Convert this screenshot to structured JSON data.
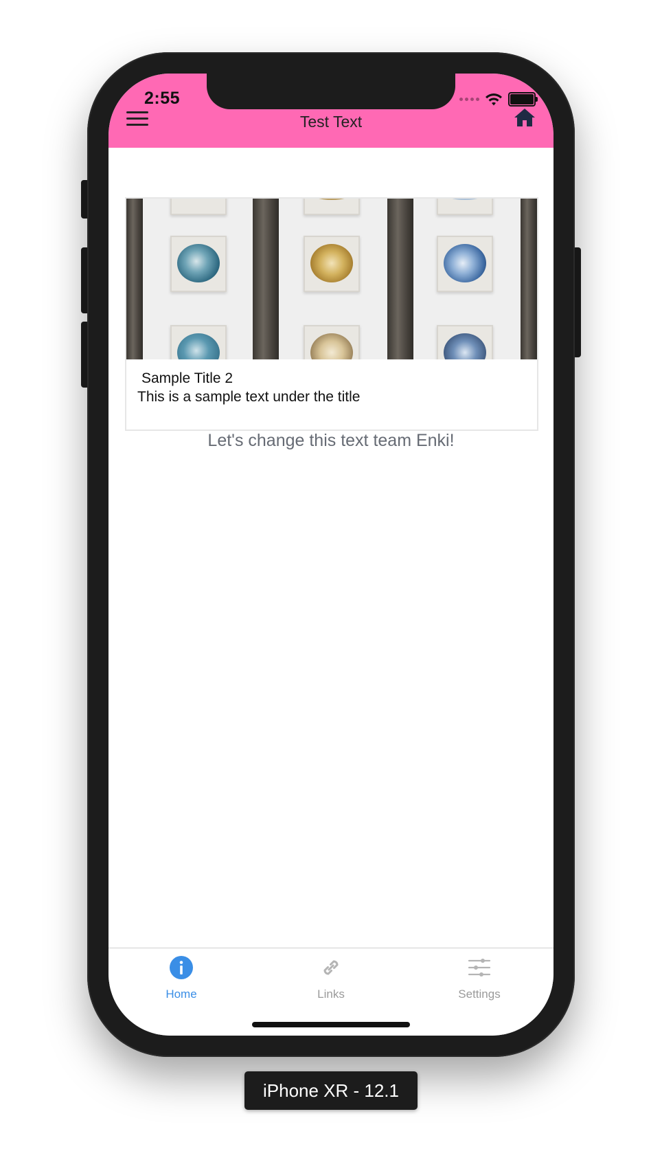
{
  "status_bar": {
    "time": "2:55"
  },
  "header": {
    "title": "Test Text",
    "menu_icon": "hamburger-icon",
    "home_icon": "home-icon",
    "background_color": "#ff69b4"
  },
  "card": {
    "title": "Sample Title 2",
    "text": "This is a sample text under the title"
  },
  "info_text": "Let's change this text team Enki!",
  "tabs": [
    {
      "label": "Home",
      "icon": "info-icon",
      "active": true,
      "color": "#3a8ee6"
    },
    {
      "label": "Links",
      "icon": "link-icon",
      "active": false,
      "color": "#9a9a9a"
    },
    {
      "label": "Settings",
      "icon": "sliders-icon",
      "active": false,
      "color": "#9a9a9a"
    }
  ],
  "device_label": "iPhone XR - 12.1"
}
